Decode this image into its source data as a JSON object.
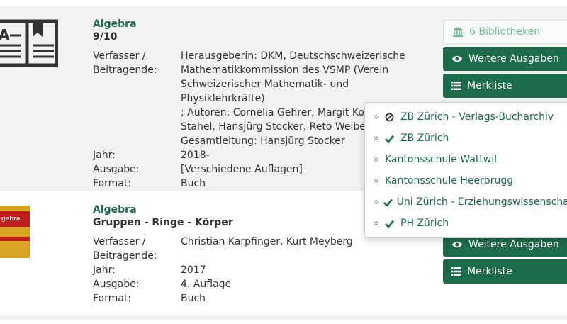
{
  "results": [
    {
      "title": "Algebra",
      "subtitle": "9/10",
      "meta": [
        {
          "key": "Verfasser /",
          "val": "Herausgeberin: DKM, Deutschschweizerische"
        },
        {
          "key": "Beitragende:",
          "val": "Mathematikkommission des VSMP (Verein"
        },
        {
          "key": "",
          "val": "Schweizerischer Mathematik- und Physiklehrkräfte)"
        },
        {
          "key": "",
          "val": "; Autoren: Cornelia Gehrer, Margit Kopp, Andreas"
        },
        {
          "key": "",
          "val": "Stahel, Hansjürg Stocker, Reto Weibel ;"
        },
        {
          "key": "",
          "val": "Gesamtleitung: Hansjürg Stocker"
        },
        {
          "key": "Jahr:",
          "val": "2018-"
        },
        {
          "key": "Ausgabe:",
          "val": "[Verschiedene Auflagen]"
        },
        {
          "key": "Format:",
          "val": "Buch"
        }
      ],
      "cover_icon": "open-book-icon",
      "buttons": {
        "libraries": "6 Bibliotheken",
        "editions": "Weitere Ausgaben",
        "watchlist": "Merkliste"
      }
    },
    {
      "title": "Algebra",
      "subtitle": "Gruppen - Ringe - Körper",
      "meta": [
        {
          "key": "Verfasser /",
          "val": "Christian Karpfinger, Kurt Meyberg"
        },
        {
          "key": "Beitragende:",
          "val": ""
        },
        {
          "key": "Jahr:",
          "val": "2017"
        },
        {
          "key": "Ausgabe:",
          "val": "4. Auflage"
        },
        {
          "key": "Format:",
          "val": "Buch"
        }
      ],
      "cover": {
        "text": "gebra",
        "color": "#d9a323",
        "band_color": "#c01d1d"
      },
      "buttons": {
        "editions": "Weitere Ausgaben",
        "watchlist": "Merkliste"
      }
    }
  ],
  "dropdown": {
    "items": [
      {
        "label": "ZB Zürich - Verlags-Bucharchiv",
        "status": "ban"
      },
      {
        "label": "ZB Zürich",
        "status": "check"
      },
      {
        "label": "Kantonsschule Wattwil",
        "status": ""
      },
      {
        "label": "Kantonsschule Heerbrugg",
        "status": ""
      },
      {
        "label": "Uni Zürich - Erziehungswissenschaft",
        "status": "check"
      },
      {
        "label": "PH Zürich",
        "status": "check"
      }
    ],
    "chevron": "»"
  },
  "colors": {
    "accent": "#1d6b4d",
    "light_accent": "#6cbf95",
    "row_bg": "#f2f2f2"
  }
}
